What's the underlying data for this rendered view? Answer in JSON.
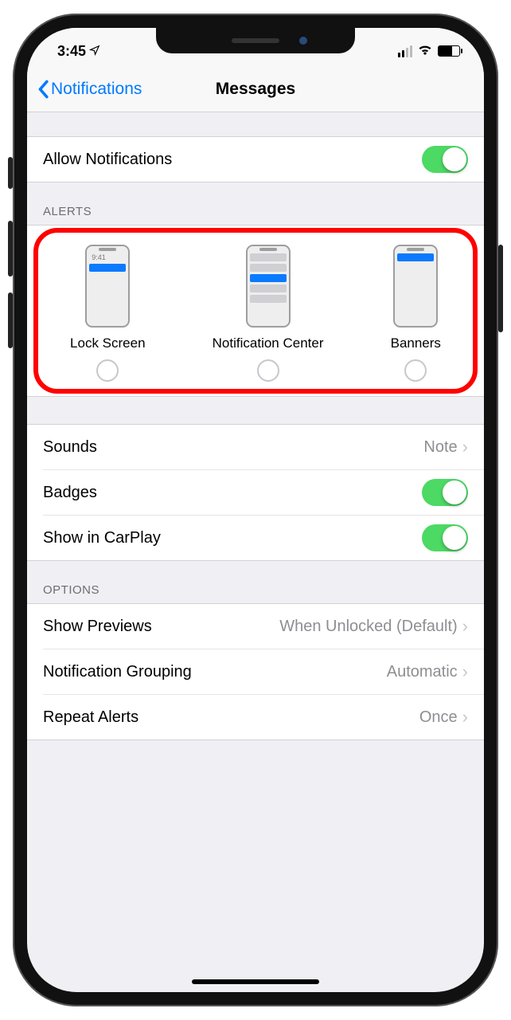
{
  "statusbar": {
    "time": "3:45"
  },
  "nav": {
    "back": "Notifications",
    "title": "Messages"
  },
  "allow": {
    "label": "Allow Notifications",
    "on": true
  },
  "alerts": {
    "header": "ALERTS",
    "mockTime": "9:41",
    "options": [
      {
        "label": "Lock Screen",
        "selected": false
      },
      {
        "label": "Notification Center",
        "selected": false
      },
      {
        "label": "Banners",
        "selected": false
      }
    ]
  },
  "rows": {
    "sounds": {
      "label": "Sounds",
      "value": "Note"
    },
    "badges": {
      "label": "Badges",
      "on": true
    },
    "carplay": {
      "label": "Show in CarPlay",
      "on": true
    }
  },
  "options": {
    "header": "OPTIONS",
    "previews": {
      "label": "Show Previews",
      "value": "When Unlocked (Default)"
    },
    "grouping": {
      "label": "Notification Grouping",
      "value": "Automatic"
    },
    "repeat": {
      "label": "Repeat Alerts",
      "value": "Once"
    }
  }
}
